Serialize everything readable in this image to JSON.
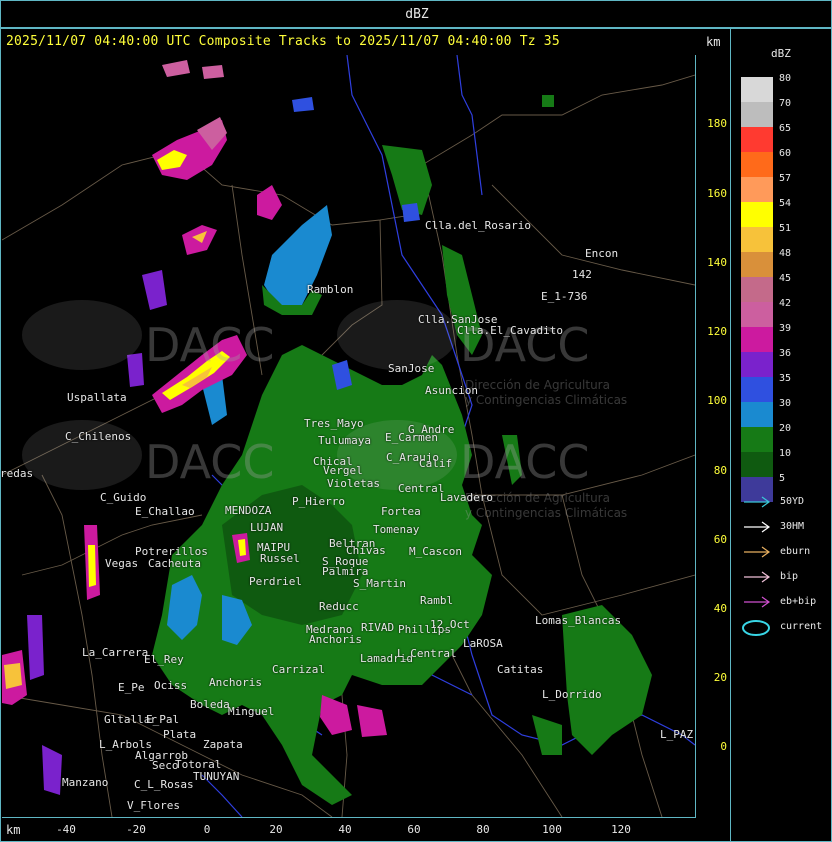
{
  "top_bar": {
    "title": "dBZ"
  },
  "header": {
    "line": "2025/11/07 04:40:00 UTC Composite Tracks to 2025/11/07 04:40:00 Tz 35",
    "km_top": "km",
    "km_bottom": "km"
  },
  "axes": {
    "y_ticks": [
      "180",
      "160",
      "140",
      "120",
      "100",
      "80",
      "60",
      "40",
      "20",
      "0"
    ],
    "x_ticks": [
      "-40",
      "-20",
      "0",
      "20",
      "40",
      "60",
      "80",
      "100",
      "120"
    ]
  },
  "watermark": {
    "logo": "DACC",
    "line1": "Dirección de Agricultura",
    "line2": "y Contingencias Climáticas"
  },
  "places": [
    {
      "name": "Clla.del_Rosario"
    },
    {
      "name": "Encon"
    },
    {
      "name": "142"
    },
    {
      "name": "E_1-736"
    },
    {
      "name": "Ramblon"
    },
    {
      "name": "Clla.SanJose"
    },
    {
      "name": "Clla.El_Cavadito"
    },
    {
      "name": "Uspallata"
    },
    {
      "name": "SanJose"
    },
    {
      "name": "Asuncion"
    },
    {
      "name": "C_Chilenos"
    },
    {
      "name": "Tres_Mayo"
    },
    {
      "name": "Tulumaya"
    },
    {
      "name": "E_Carmen"
    },
    {
      "name": "G_Andre"
    },
    {
      "name": "C_Araujo"
    },
    {
      "name": "Calif"
    },
    {
      "name": "Chical"
    },
    {
      "name": "Vergel"
    },
    {
      "name": "redas"
    },
    {
      "name": "Violetas"
    },
    {
      "name": "Central"
    },
    {
      "name": "Lavadero"
    },
    {
      "name": "C_Guido"
    },
    {
      "name": "E_Challao"
    },
    {
      "name": "P_Hierro"
    },
    {
      "name": "Fortea"
    },
    {
      "name": "Tomenay"
    },
    {
      "name": "Beltran"
    },
    {
      "name": "Potrerillos"
    },
    {
      "name": "Chivas"
    },
    {
      "name": "M_Cascon"
    },
    {
      "name": "Vegas"
    },
    {
      "name": "Cacheuta"
    },
    {
      "name": "Russel"
    },
    {
      "name": "Perdriel"
    },
    {
      "name": "S_Roque"
    },
    {
      "name": "Palmira"
    },
    {
      "name": "S_Martin"
    },
    {
      "name": "Rambl"
    },
    {
      "name": "Reducc"
    },
    {
      "name": "RIVAD"
    },
    {
      "name": "Phillips"
    },
    {
      "name": "Medrano"
    },
    {
      "name": "Anchoris"
    },
    {
      "name": "12_Oct"
    },
    {
      "name": "La_Carrera"
    },
    {
      "name": "El_Rey"
    },
    {
      "name": "Carrizal"
    },
    {
      "name": "Lamadrid"
    },
    {
      "name": "L_Central"
    },
    {
      "name": "LaROSA"
    },
    {
      "name": "Lomas_Blancas"
    },
    {
      "name": "Catitas"
    },
    {
      "name": "E_Pe"
    },
    {
      "name": "Ociss"
    },
    {
      "name": "Anchoris"
    },
    {
      "name": "Minguel"
    },
    {
      "name": "Gltallar"
    },
    {
      "name": "E_Pal"
    },
    {
      "name": "Boleda"
    },
    {
      "name": "L_Dorrido"
    },
    {
      "name": "Plata"
    },
    {
      "name": "L_Arbols"
    },
    {
      "name": "Zapata"
    },
    {
      "name": "Algarrob"
    },
    {
      "name": "Seco"
    },
    {
      "name": "Totoral"
    },
    {
      "name": "TUNUYAN"
    },
    {
      "name": "Manzano"
    },
    {
      "name": "C_L_Rosas"
    },
    {
      "name": "V_Flores"
    },
    {
      "name": "L_PAZ"
    },
    {
      "name": "MENDOZA"
    },
    {
      "name": "LUJAN"
    },
    {
      "name": "MAIPU"
    }
  ],
  "legend": {
    "unit": "dBZ",
    "levels": [
      {
        "label": "80",
        "color": "#d8d8d8"
      },
      {
        "label": "70",
        "color": "#bdbdbd"
      },
      {
        "label": "65",
        "color": "#ff3a30"
      },
      {
        "label": "60",
        "color": "#ff6a1a"
      },
      {
        "label": "57",
        "color": "#ff9a5a"
      },
      {
        "label": "54",
        "color": "#ffff00"
      },
      {
        "label": "51",
        "color": "#f7c23a"
      },
      {
        "label": "48",
        "color": "#d9903a"
      },
      {
        "label": "45",
        "color": "#c46a8a"
      },
      {
        "label": "42",
        "color": "#cc5f9f"
      },
      {
        "label": "39",
        "color": "#cc1a9f"
      },
      {
        "label": "36",
        "color": "#7a22cc"
      },
      {
        "label": "35",
        "color": "#2f50e0"
      },
      {
        "label": "30",
        "color": "#1a8ad0"
      },
      {
        "label": "20",
        "color": "#167a16"
      },
      {
        "label": "10",
        "color": "#0f5a10"
      },
      {
        "label": "5",
        "color": "#3e3a9a"
      }
    ]
  },
  "tracks": [
    {
      "label": "50YD",
      "color": "#39c7d6"
    },
    {
      "label": "30HM",
      "color": "#ffffff"
    },
    {
      "label": "eburn",
      "color": "#e8b060"
    },
    {
      "label": "bip",
      "color": "#f0c0d8"
    },
    {
      "label": "eb+bip",
      "color": "#d050d0"
    },
    {
      "label": "current",
      "color": "#39d6e6"
    }
  ]
}
